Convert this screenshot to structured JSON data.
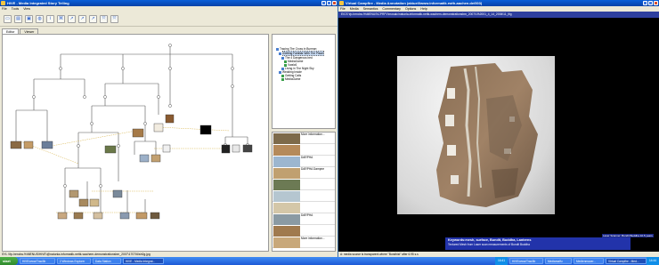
{
  "left_window": {
    "title": "HiVE - Media Integrated Story Telling",
    "menu": [
      "File",
      "Tools",
      "View"
    ],
    "tabs": [
      "Editor",
      "Viewer"
    ],
    "outline": [
      {
        "label": "Tracing The Cross in Burman",
        "indent": 0,
        "icon": "blue"
      },
      {
        "label": "Getting Familiar With The Place",
        "indent": 1,
        "icon": "blue",
        "selected": true
      },
      {
        "label": "The 4 Dangerous bed",
        "indent": 2,
        "icon": "blue"
      },
      {
        "label": "MediaGame",
        "indent": 3,
        "icon": "green"
      },
      {
        "label": "Vwalc6",
        "indent": 3,
        "icon": "green"
      },
      {
        "label": "Living in The Night Sky",
        "indent": 2,
        "icon": "blue"
      },
      {
        "label": "Wedding Inside",
        "indent": 1,
        "icon": "blue"
      },
      {
        "label": "Getting Calls",
        "indent": 2,
        "icon": "green"
      },
      {
        "label": "MediaGame",
        "indent": 2,
        "icon": "green"
      }
    ],
    "media_list": [
      {
        "label": "More information...",
        "swatch": "#7d6a4a"
      },
      {
        "label": "",
        "swatch": "#b58a5a"
      },
      {
        "label": "DARPHA",
        "swatch": "#9cb6cf"
      },
      {
        "label": "DARPHA Dampne",
        "swatch": "#c0a070"
      },
      {
        "label": "",
        "swatch": "#6c7a54"
      },
      {
        "label": "",
        "swatch": "#b5c6d0"
      },
      {
        "label": "",
        "swatch": "#d4c7a8"
      },
      {
        "label": "DARPHA",
        "swatch": "#8a9aa3"
      },
      {
        "label": "",
        "swatch": "#a07a4e"
      },
      {
        "label": "More information...",
        "swatch": "#c8a87a"
      }
    ],
    "status": "SYL \\\\fp-hendra-%\\MENUS\\HiVE\\@natunla-informatik-nettk-wachem-demonstrationsbm_2007\\1707\\6\\sh0g.jpg"
  },
  "right_window": {
    "title": "Virtual Campfire - Media Annotation (aktuell/www.informatik.rwth-aachen.de/003)",
    "menu": [
      "File",
      "Media",
      "Semantics",
      "Commentary",
      "Options",
      "Help"
    ],
    "path": "EICS \\fp-hendra-%\\MENUS\\CPRFV\\mosaic\\natunla-informatik-nettk-wachem-demonstrationsbm_2007\\19\\2001_4_14_2006\\11_ifig",
    "caption_keywords": "Keywords:mesh, surface, Bundit, Buddha, Lanterns",
    "caption_desc": "Textured Mesh from Laser scan measurements of Bundit Buddha",
    "timeline_tag": "Laser Scanner: Bundit Buddha 10.5 years",
    "status": "A: media source is transparent where \"Bundhist\" after 6.95 s.s"
  },
  "taskbar": {
    "start": "start",
    "tasks": [
      {
        "label": "HiVE/www/Trac/lib",
        "active": false
      },
      {
        "label": "2 Windows Explorer",
        "active": false
      },
      {
        "label": "Data Station",
        "active": false
      },
      {
        "label": "HiVE - Media Integrat...",
        "active": true
      },
      {
        "label": "HiVE/www/Trac/lib",
        "active": false
      },
      {
        "label": "Mediamalfu",
        "active": false
      },
      {
        "label": "Medienmauer...",
        "active": false
      },
      {
        "label": "Virtual Campfire - Med...",
        "active": true
      }
    ],
    "clock_left": "16:41",
    "clock_right": "14:44"
  },
  "colors": {
    "xp_blue": "#0a5fd8",
    "caption_blue": "#2233aa",
    "tree_line": "#555555",
    "cross_link": "#d8b44a"
  }
}
